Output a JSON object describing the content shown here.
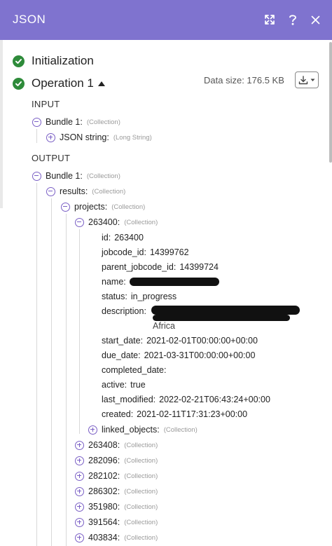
{
  "header": {
    "title": "JSON"
  },
  "sections": {
    "initialization": "Initialization",
    "operation": "Operation 1",
    "data_size": "Data size: 176.5 KB"
  },
  "input": {
    "label": "INPUT",
    "bundle": {
      "key": "Bundle 1:",
      "type": "(Collection)"
    },
    "json_string": {
      "key": "JSON string:",
      "type": "(Long String)"
    }
  },
  "output": {
    "label": "OUTPUT",
    "bundle": {
      "key": "Bundle 1:",
      "type": "(Collection)"
    },
    "results": {
      "key": "results:",
      "type": "(Collection)"
    },
    "projects": {
      "key": "projects:",
      "type": "(Collection)"
    },
    "project_open": {
      "key": "263400:",
      "type": "(Collection)",
      "fields": [
        {
          "key": "id:",
          "value": "263400"
        },
        {
          "key": "jobcode_id:",
          "value": "14399762"
        },
        {
          "key": "parent_jobcode_id:",
          "value": "14399724"
        },
        {
          "key": "name:",
          "value": ""
        },
        {
          "key": "status:",
          "value": "in_progress"
        },
        {
          "key": "description:",
          "value": ""
        },
        {
          "key": "start_date:",
          "value": "2021-02-01T00:00:00+00:00"
        },
        {
          "key": "due_date:",
          "value": "2021-03-31T00:00:00+00:00"
        },
        {
          "key": "completed_date:",
          "value": ""
        },
        {
          "key": "active:",
          "value": "true"
        },
        {
          "key": "last_modified:",
          "value": "2022-02-21T06:43:24+00:00"
        },
        {
          "key": "created:",
          "value": "2021-02-11T17:31:23+00:00"
        }
      ],
      "description_tail": "Africa",
      "linked_objects": {
        "key": "linked_objects:",
        "type": "(Collection)"
      }
    },
    "collapsed_projects": [
      {
        "key": "263408:",
        "type": "(Collection)"
      },
      {
        "key": "282096:",
        "type": "(Collection)"
      },
      {
        "key": "282102:",
        "type": "(Collection)"
      },
      {
        "key": "286302:",
        "type": "(Collection)"
      },
      {
        "key": "351980:",
        "type": "(Collection)"
      },
      {
        "key": "391564:",
        "type": "(Collection)"
      },
      {
        "key": "403834:",
        "type": "(Collection)"
      }
    ]
  },
  "icons": {
    "expand": "expand-arrows-icon",
    "help": "question-mark-icon",
    "close": "close-icon",
    "success": "check-circle-icon",
    "download": "download-icon"
  },
  "colors": {
    "header_bg": "#7f73cf",
    "success": "#2e8b3a",
    "toggle": "#7a5fc5"
  }
}
